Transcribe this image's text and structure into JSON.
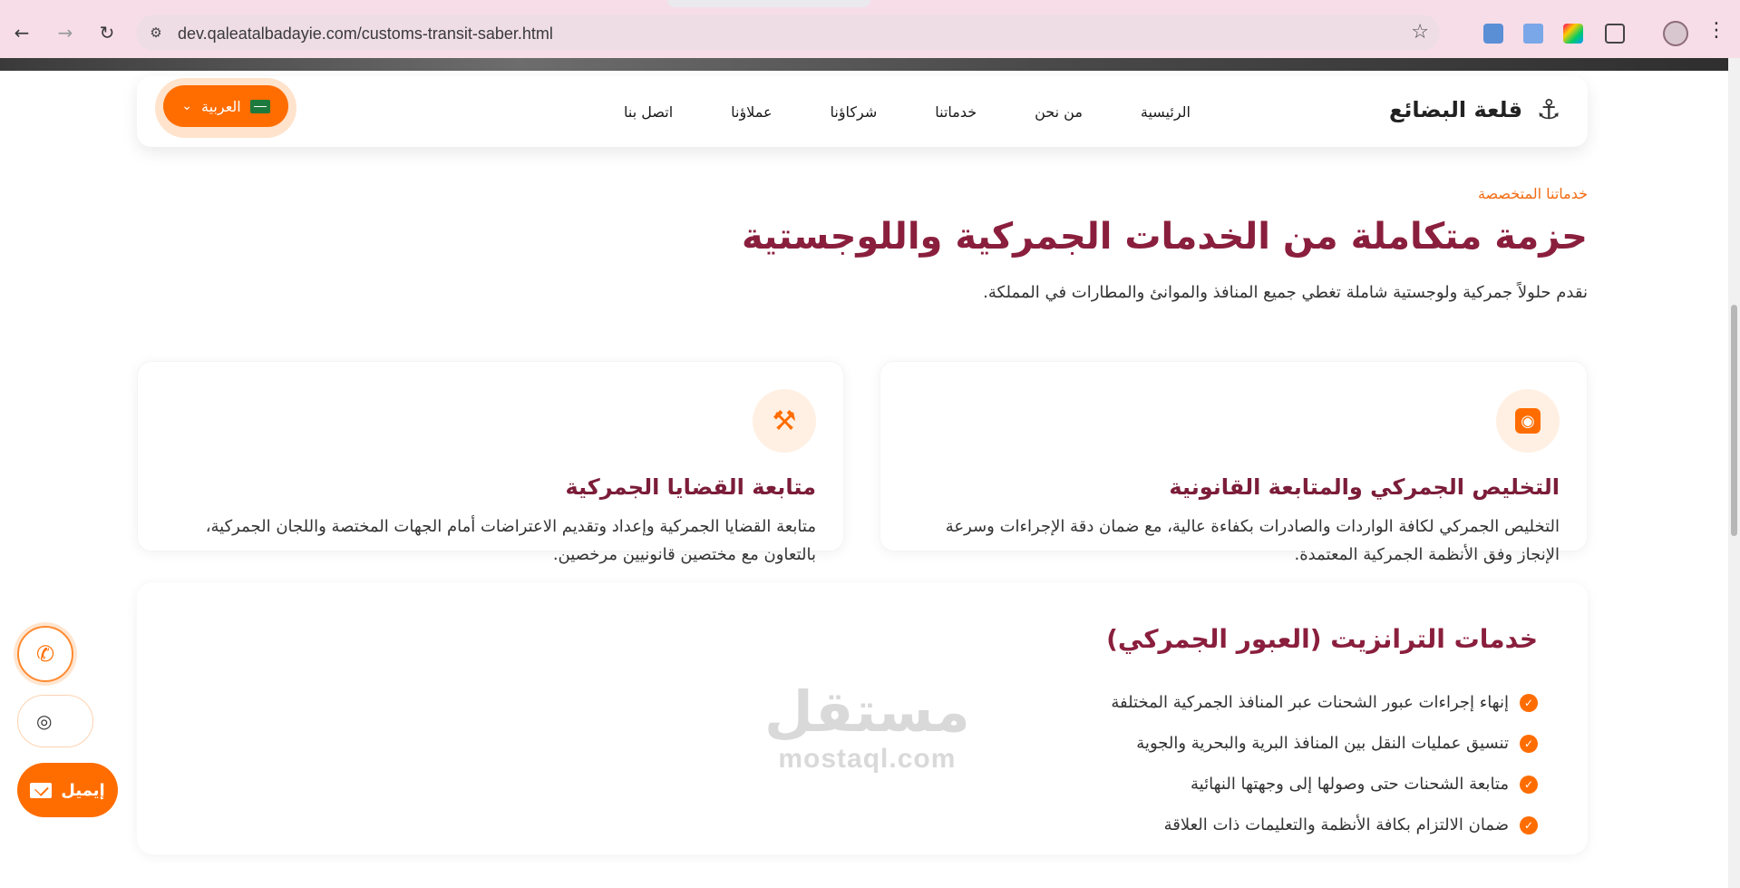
{
  "browser": {
    "url": "dev.qaleatalbadayie.com/customs-transit-saber.html",
    "icons": {
      "back": "arrow-left-icon",
      "forward": "arrow-right-icon",
      "reload": "reload-icon",
      "site_info": "tune-icon",
      "bookmark": "star-icon",
      "menu": "kebab-menu-icon"
    }
  },
  "navbar": {
    "brand_name": "قلعة البضائع",
    "links": [
      "الرئيسية",
      "من نحن",
      "خدماتنا",
      "شركاؤنا",
      "عملاؤنا",
      "اتصل بنا"
    ],
    "language_label": "العربية"
  },
  "section": {
    "eyebrow": "خدماتنا المتخصصة",
    "heading": "حزمة متكاملة من الخدمات الجمركية واللوجستية",
    "lead": "نقدم حلولاً جمركية ولوجستية شاملة تغطي جميع المنافذ والموانئ والمطارات في المملكة."
  },
  "cards": [
    {
      "icon": "passport-icon",
      "title": "التخليص الجمركي والمتابعة القانونية",
      "body": "التخليص الجمركي لكافة الواردات والصادرات بكفاءة عالية، مع ضمان دقة الإجراءات وسرعة الإنجاز وفق الأنظمة الجمركية المعتمدة."
    },
    {
      "icon": "gavel-icon",
      "title": "متابعة القضايا الجمركية",
      "body": "متابعة القضايا الجمركية وإعداد وتقديم الاعتراضات أمام الجهات المختصة واللجان الجمركية، بالتعاون مع مختصين قانونيين مرخصين."
    }
  ],
  "transit": {
    "title": "خدمات الترانزيت (العبور الجمركي)",
    "items": [
      "إنهاء إجراءات عبور الشحنات عبر المنافذ الجمركية المختلفة",
      "تنسيق عمليات النقل بين المنافذ البرية والبحرية والجوية",
      "متابعة الشحنات حتى وصولها إلى وجهتها النهائية",
      "ضمان الالتزام بكافة الأنظمة والتعليمات ذات العلاقة"
    ]
  },
  "watermark": {
    "arabic": "مستقل",
    "latin": "mostaql.com"
  },
  "floating": {
    "email_label": "إيميل"
  },
  "colors": {
    "accent": "#ff6d00",
    "heading": "#8a1f3d",
    "browser_chrome": "#f7dde8"
  }
}
